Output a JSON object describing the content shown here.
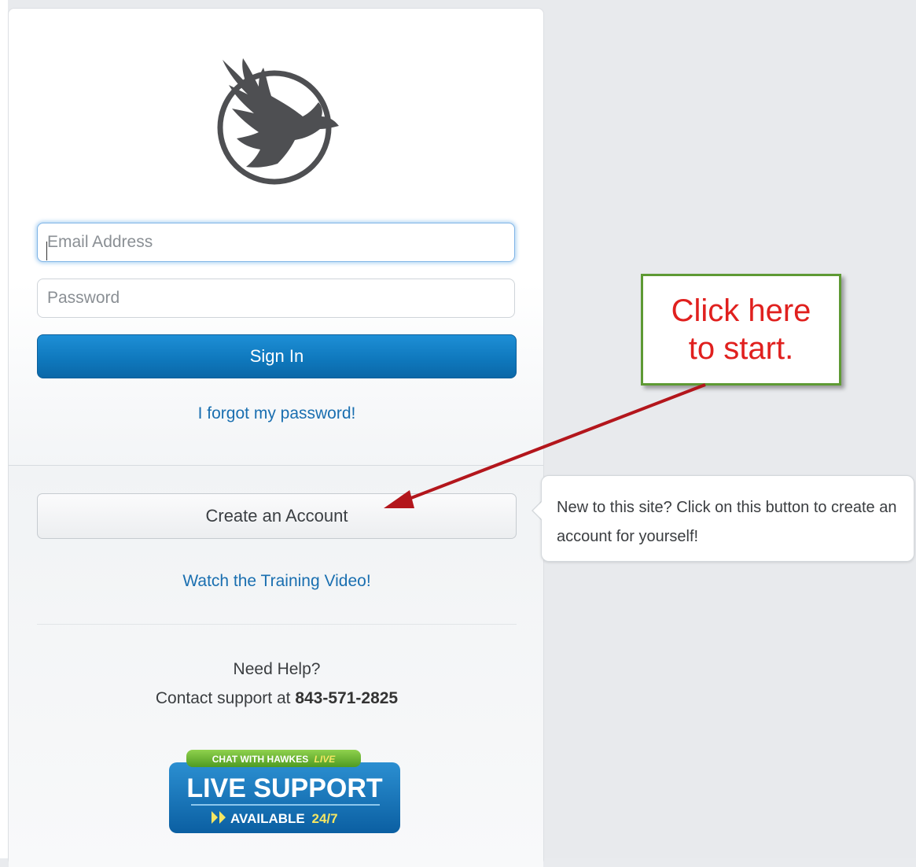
{
  "login": {
    "email_placeholder": "Email Address",
    "password_placeholder": "Password",
    "sign_in_label": "Sign In",
    "forgot_password_link": "I forgot my password!",
    "create_account_label": "Create an Account",
    "training_video_link": "Watch the Training Video!",
    "need_help": "Need Help?",
    "contact_prefix": "Contact support at",
    "support_phone": "843-571-2825"
  },
  "live_support_badge": {
    "top_text": "CHAT WITH HAWKES",
    "top_text_live": "LIVE",
    "main_text": "LIVE SUPPORT",
    "bottom_text": "AVAILABLE",
    "bottom_hours": "24/7"
  },
  "annotation": {
    "callout_line1": "Click here",
    "callout_line2": "to start.",
    "tooltip_text": "New to this site? Click on this button to create an account for yourself!"
  },
  "colors": {
    "primary_button": "#0f79be",
    "link": "#1a6fb0",
    "callout_text": "#e0201e",
    "callout_border": "#5e9a34",
    "arrow": "#b3161c"
  },
  "icons": {
    "logo": "eagle-logo-icon",
    "arrow": "annotation-arrow-icon"
  }
}
